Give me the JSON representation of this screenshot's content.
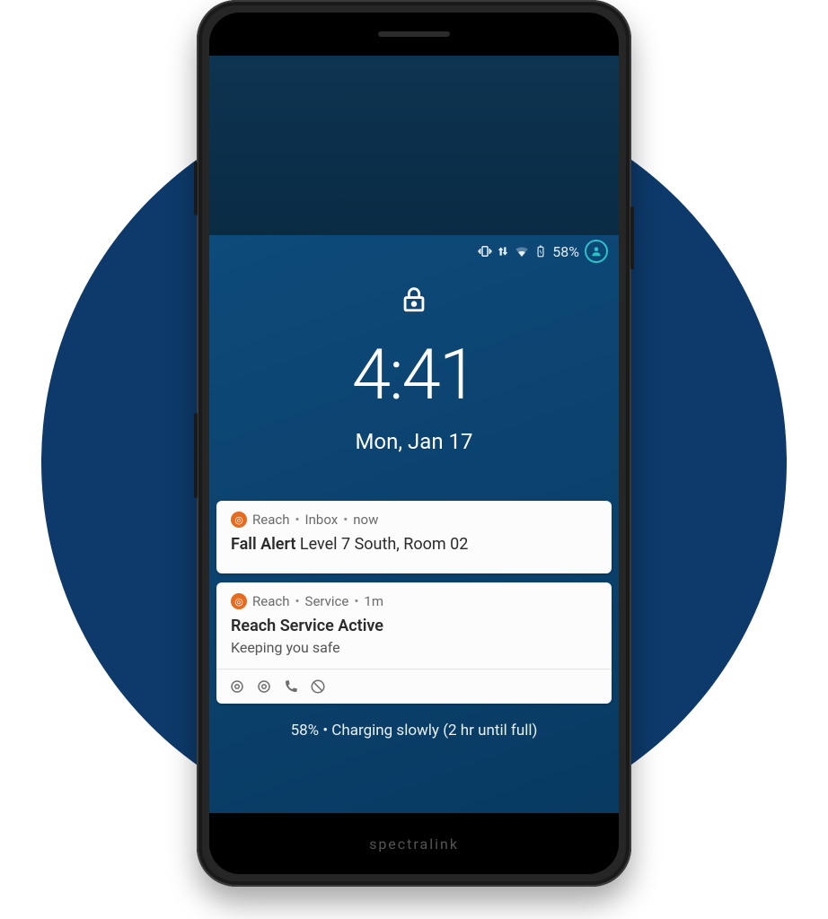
{
  "status": {
    "battery_pct": "58%"
  },
  "lockscreen": {
    "time": "4:41",
    "date": "Mon, Jan 17"
  },
  "notifications": [
    {
      "app": "Reach",
      "channel": "Inbox",
      "when": "now",
      "title": "Fall Alert",
      "text": "Level 7 South, Room 02"
    },
    {
      "app": "Reach",
      "channel": "Service",
      "when": "1m",
      "title": "Reach Service Active",
      "subtitle": "Keeping you safe"
    }
  ],
  "charging": "58% • Charging slowly (2 hr until full)",
  "brand": "spectralink"
}
